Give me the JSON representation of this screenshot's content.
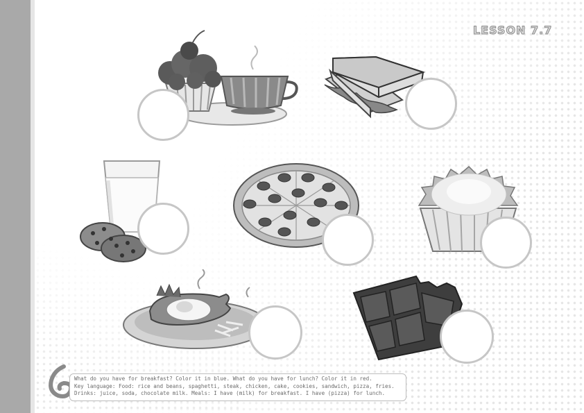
{
  "lesson_label": "LESSON 7.7",
  "instructions": {
    "line1": "What do you have for breakfast? Color it in blue. What do you have for lunch? Color it in red.",
    "line2": "Key language: Food: rice and beans, spaghetti, steak, chicken, cake, cookies, sandwich, pizza, fries.",
    "line3": "Drinks: juice, soda, chocolate milk. Meals: I have (milk) for breakfast. I have (pizza) for lunch."
  },
  "pictures": [
    "cake-icon",
    "coffee-cup-icon",
    "sandwich-icon",
    "milk-glass-icon",
    "cookies-icon",
    "pizza-icon",
    "cupcake-icon",
    "steak-plate-icon",
    "chocolate-bar-icon"
  ],
  "colors": {
    "spine": "#a9a9a9",
    "circle_border": "#c6c6c6",
    "text": "#6b6b6b"
  }
}
